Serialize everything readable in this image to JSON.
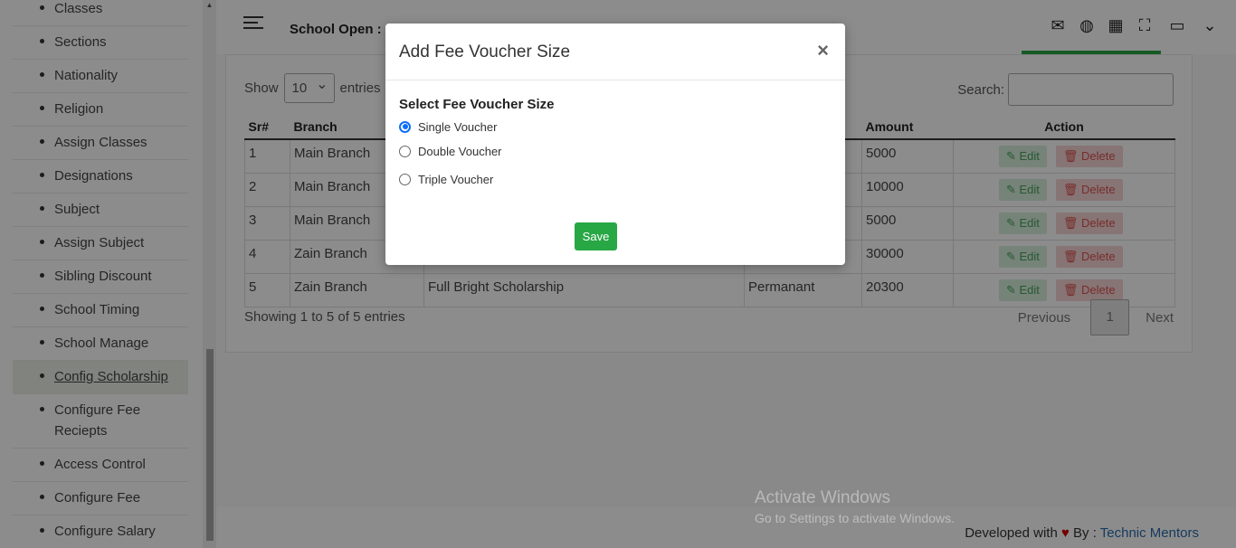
{
  "sidebar": {
    "items": [
      {
        "label": "Classes"
      },
      {
        "label": "Sections"
      },
      {
        "label": "Nationality"
      },
      {
        "label": "Religion"
      },
      {
        "label": "Assign Classes"
      },
      {
        "label": "Designations"
      },
      {
        "label": "Subject"
      },
      {
        "label": "Assign Subject"
      },
      {
        "label": "Sibling Discount"
      },
      {
        "label": "School Timing"
      },
      {
        "label": "School Manage"
      },
      {
        "label": "Config Scholarship"
      },
      {
        "label": "Configure Fee Reciepts"
      },
      {
        "label": "Access Control"
      },
      {
        "label": "Configure Fee"
      },
      {
        "label": "Configure Salary"
      }
    ]
  },
  "header": {
    "school_open": "School Open :",
    "icons": [
      "mail-icon",
      "globe-icon",
      "apps-grid-icon",
      "fullscreen-icon",
      "avatar",
      "chevron-down-icon"
    ]
  },
  "table_controls": {
    "show_label": "Show",
    "entries_value": "10",
    "entries_label": "entries",
    "search_label": "Search:",
    "search_value": ""
  },
  "table": {
    "columns": [
      "Sr#",
      "Branch",
      "Amount",
      "Action"
    ],
    "rows": [
      {
        "sr": "1",
        "branch": "Main Branch",
        "scholarship": "",
        "type": "",
        "amount": "5000"
      },
      {
        "sr": "2",
        "branch": "Main Branch",
        "scholarship": "",
        "type": "",
        "amount": "10000"
      },
      {
        "sr": "3",
        "branch": "Main Branch",
        "scholarship": "",
        "type": "",
        "amount": "5000"
      },
      {
        "sr": "4",
        "branch": "Zain Branch",
        "scholarship": "",
        "type": "",
        "amount": "30000"
      },
      {
        "sr": "5",
        "branch": "Zain Branch",
        "scholarship": "Full Bright Scholarship",
        "type": "Permanant",
        "amount": "20300"
      }
    ],
    "edit_label": "✎ Edit",
    "delete_label": "🗑 Delete"
  },
  "pagination": {
    "summary": "Showing 1 to 5 of 5 entries",
    "previous": "Previous",
    "page": "1",
    "next": "Next"
  },
  "footer": {
    "developed_with": "Developed with",
    "heart": "♥",
    "by": "By :",
    "company": "Technic Mentors"
  },
  "watermark": {
    "line1": "Activate Windows",
    "line2": "Go to Settings to activate Windows."
  },
  "modal": {
    "title": "Add Fee Voucher Size",
    "close": "×",
    "heading": "Select Fee Voucher Size",
    "options": [
      {
        "label": "Single Voucher",
        "checked": true
      },
      {
        "label": "Double Voucher",
        "checked": false
      },
      {
        "label": "Triple Voucher",
        "checked": false
      }
    ],
    "save_label": "Save"
  }
}
